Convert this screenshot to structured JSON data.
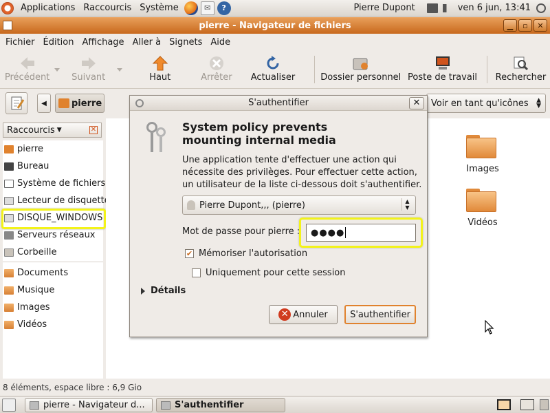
{
  "top_panel": {
    "menus": [
      "Applications",
      "Raccourcis",
      "Système"
    ],
    "user": "Pierre Dupont",
    "clock": "ven  6 jun, 13:41"
  },
  "window": {
    "title": "pierre - Navigateur de fichiers",
    "menus": [
      "Fichier",
      "Édition",
      "Affichage",
      "Aller à",
      "Signets",
      "Aide"
    ],
    "toolbar": {
      "back": "Précédent",
      "forward": "Suivant",
      "up": "Haut",
      "stop": "Arrêter",
      "reload": "Actualiser",
      "home": "Dossier personnel",
      "computer": "Poste de travail",
      "search": "Rechercher"
    },
    "location": {
      "crumb": "pierre",
      "view_mode": "Voir en tant qu'icônes"
    }
  },
  "sidebar": {
    "title": "Raccourcis",
    "items": [
      {
        "label": "pierre",
        "icon": "home-folder-icon"
      },
      {
        "label": "Bureau",
        "icon": "desktop-icon"
      },
      {
        "label": "Système de fichiers",
        "icon": "filesystem-icon"
      },
      {
        "label": "Lecteur de disquette",
        "icon": "floppy-icon"
      },
      {
        "label": "DISQUE_WINDOWS",
        "icon": "drive-icon"
      },
      {
        "label": "Serveurs réseaux",
        "icon": "network-icon"
      },
      {
        "label": "Corbeille",
        "icon": "trash-icon"
      }
    ],
    "bookmarks": [
      {
        "label": "Documents",
        "icon": "folder-icon"
      },
      {
        "label": "Musique",
        "icon": "folder-icon"
      },
      {
        "label": "Images",
        "icon": "folder-icon"
      },
      {
        "label": "Vidéos",
        "icon": "folder-icon"
      }
    ]
  },
  "content": {
    "folders": [
      "Images",
      "Vidéos"
    ]
  },
  "status": "8 éléments, espace libre : 6,9 Gio",
  "dialog": {
    "title": "S'authentifier",
    "heading_line1": "System policy prevents",
    "heading_line2": "mounting internal media",
    "desc_line1": "Une application tente d'effectuer une action qui",
    "desc_line2": "nécessite des privilèges. Pour effectuer cette action,",
    "desc_line3": "un utilisateur de la liste ci-dessous doit s'authentifier.",
    "user_option": "Pierre Dupont,,, (pierre)",
    "password_label": "Mot de passe pour pierre :",
    "password_value": "●●●●",
    "remember_label": "Mémoriser l'autorisation",
    "remember_checked": true,
    "session_only_label": "Uniquement pour cette session",
    "session_only_checked": false,
    "details_label": "Détails",
    "cancel_label": "Annuler",
    "auth_label": "S'authentifier"
  },
  "taskbar": {
    "tasks": [
      "pierre - Navigateur d...",
      "S'authentifier"
    ]
  }
}
